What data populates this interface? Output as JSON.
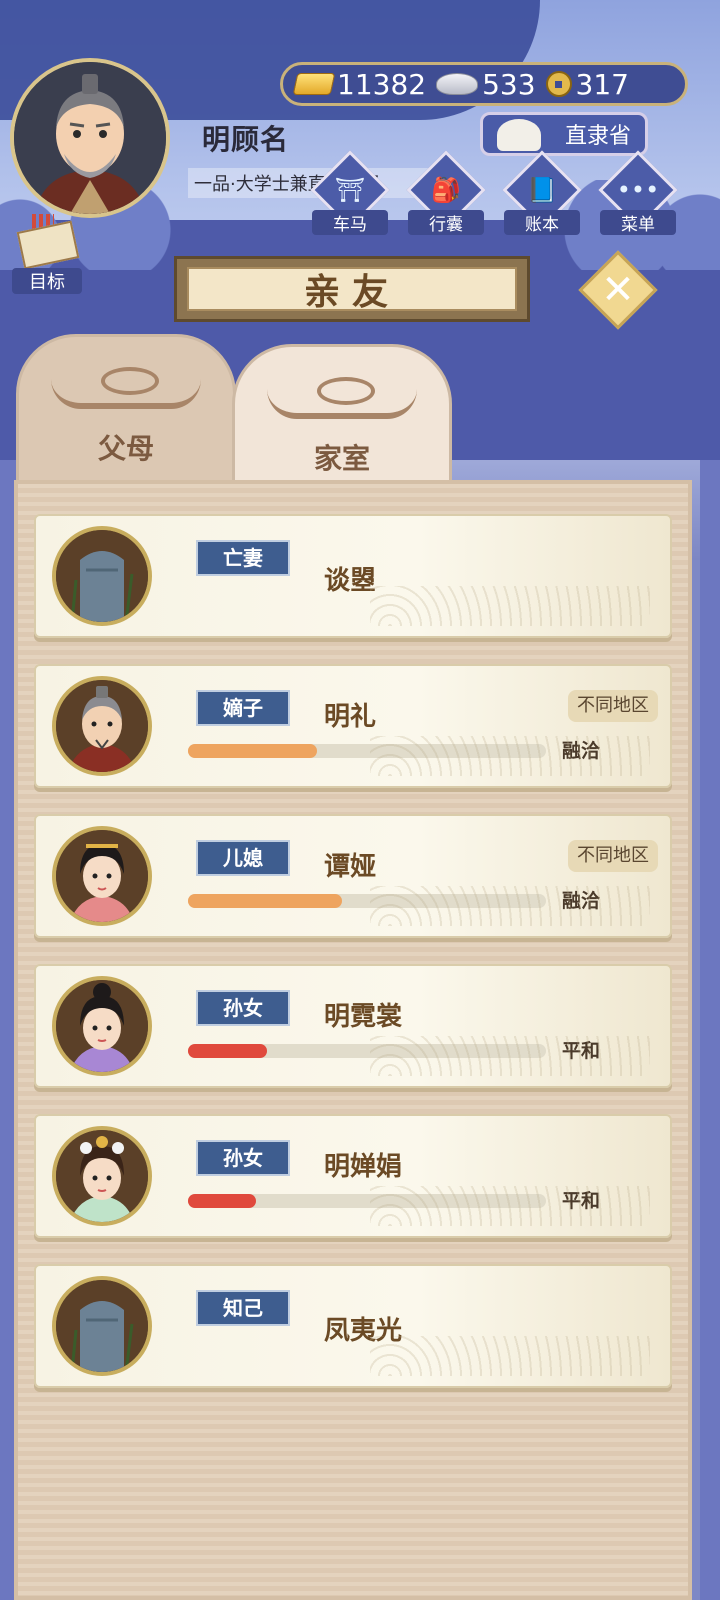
{
  "player": {
    "name": "明顾名",
    "title": "一品·大学士兼直隶总督"
  },
  "resources": {
    "gold": "11382",
    "silver": "533",
    "coins": "317"
  },
  "region": {
    "label": "直隶省"
  },
  "nav": [
    {
      "label": "车马",
      "icon": "carriage-icon",
      "glyph": "⛩"
    },
    {
      "label": "行囊",
      "icon": "bundle-icon",
      "glyph": "🎒"
    },
    {
      "label": "账本",
      "icon": "ledger-icon",
      "glyph": "📘"
    },
    {
      "label": "菜单",
      "icon": "menu-dots-icon",
      "glyph": "•••"
    }
  ],
  "goal": {
    "label": "目标"
  },
  "panel": {
    "title": "亲友",
    "close_glyph": "✕",
    "tabs": [
      {
        "label": "父母",
        "active": false
      },
      {
        "label": "家室",
        "active": true
      }
    ]
  },
  "relatives": [
    {
      "relation": "亡妻",
      "name": "谈曌",
      "deceased": true
    },
    {
      "relation": "嫡子",
      "name": "明礼",
      "location": "不同地区",
      "mood": "融洽",
      "affinity": 0.36,
      "bar_color": "#eea45f"
    },
    {
      "relation": "儿媳",
      "name": "谭娅",
      "location": "不同地区",
      "mood": "融洽",
      "affinity": 0.43,
      "bar_color": "#eea45f"
    },
    {
      "relation": "孙女",
      "name": "明霓裳",
      "mood": "平和",
      "affinity": 0.22,
      "bar_color": "#e0493c"
    },
    {
      "relation": "孙女",
      "name": "明婵娟",
      "mood": "平和",
      "affinity": 0.19,
      "bar_color": "#e0493c"
    },
    {
      "relation": "知己",
      "name": "凤夷光",
      "deceased": true
    }
  ]
}
